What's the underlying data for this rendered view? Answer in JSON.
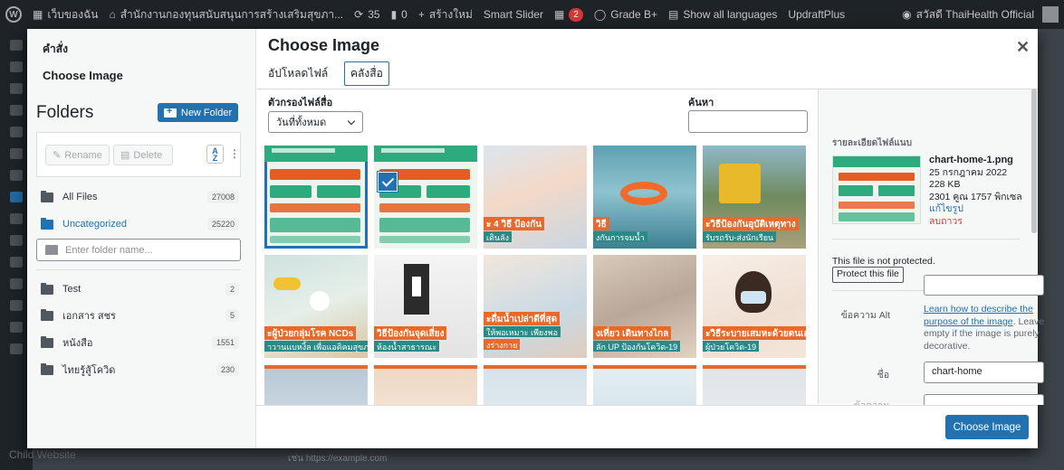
{
  "admin_bar": {
    "site_name": "เว็บของฉัน",
    "org_name": "สำนักงานกองทุนสนับสนุนการสร้างเสริมสุขภา...",
    "updates_count": "35",
    "comments_count": "0",
    "new_label": "สร้างใหม่",
    "smart_slider": "Smart Slider",
    "notifications_count": "2",
    "grade": "Grade B+",
    "show_languages": "Show all languages",
    "updraft": "UpdraftPlus",
    "greeting": "สวัสดี ThaiHealth Official"
  },
  "background": {
    "child_website": "Child Website",
    "url_hint": "เช่น https://example.com"
  },
  "menu": {
    "actions_title": "คำสั่ง",
    "choose_image": "Choose Image"
  },
  "folders": {
    "title": "Folders",
    "new_folder": "New Folder",
    "rename": "Rename",
    "delete": "Delete",
    "all_files": {
      "label": "All Files",
      "count": "27008"
    },
    "uncategorized": {
      "label": "Uncategorized",
      "count": "25220"
    },
    "input_placeholder": "Enter folder name...",
    "items": [
      {
        "label": "Test",
        "count": "2"
      },
      {
        "label": "เอกสาร สชร",
        "count": "5"
      },
      {
        "label": "หนังสือ",
        "count": "1551"
      },
      {
        "label": "ไทยรู้สู้โควิด",
        "count": "230"
      }
    ]
  },
  "frame": {
    "title": "Choose Image",
    "tabs": [
      "อัปโหลดไฟล์",
      "คลังสื่อ"
    ],
    "filter_label": "ตัวกรองไฟล์สื่อ",
    "filter_value": "วันที่ทั้งหมด",
    "search_label": "ค้นหา"
  },
  "grid": {
    "captions": [
      "ะ 4 วิธี ป้องกัน",
      "เดินลัง",
      "วิธี",
      "งกันการจมน้ำ",
      "ะวิธีป้องกันอุบัติเหตุทาง",
      "รับรถรับ-ส่งนักเรียน",
      "ะผู้ป่วยกลุ่มโรค NCDs",
      "าวานแบหงิ้ล เพื่อแอดิคมสุขภาพ",
      "วิธีป้องกันจุดเสี่ยง",
      "ห้องน้ำสาธารณะ",
      "ะดื่มน้ำเปล่าดีที่สุด",
      "ให้พอเหมาะ เพียงพอ",
      "งร่างกาย",
      "งเที่ยว เดินทางไกล",
      "ลัก UP ป้องกันโควิด-19",
      "ะวิธีระบายเสมหะด้วยตนเอง",
      "ผู้ป่วยโควิด-19"
    ]
  },
  "details": {
    "title": "รายละเอียดไฟล์แนบ",
    "filename": "chart-home-1.png",
    "date": "25 กรกฎาคม 2022",
    "size": "228 KB",
    "dimensions": "2301 คูณ 1757 พิกเซล",
    "edit_link": "แก้ไขรูป",
    "delete_link": "ลบถาวร",
    "protect_text": "This file is not protected.",
    "protect_button": "Protect this file",
    "alt_label": "ข้อความ Alt",
    "alt_help_link": "Learn how to describe the purpose of the image",
    "alt_help_rest": ". Leave empty if the image is purely decorative.",
    "name_label": "ชื่อ",
    "name_value": "chart-home",
    "next_label": "ข้อความอธิบาย"
  },
  "toolbar": {
    "choose_button": "Choose Image"
  },
  "colors": {
    "accent": "#2271b1",
    "danger": "#d63638",
    "chart_green": "#2eab7e",
    "chart_orange": "#e65c24"
  }
}
